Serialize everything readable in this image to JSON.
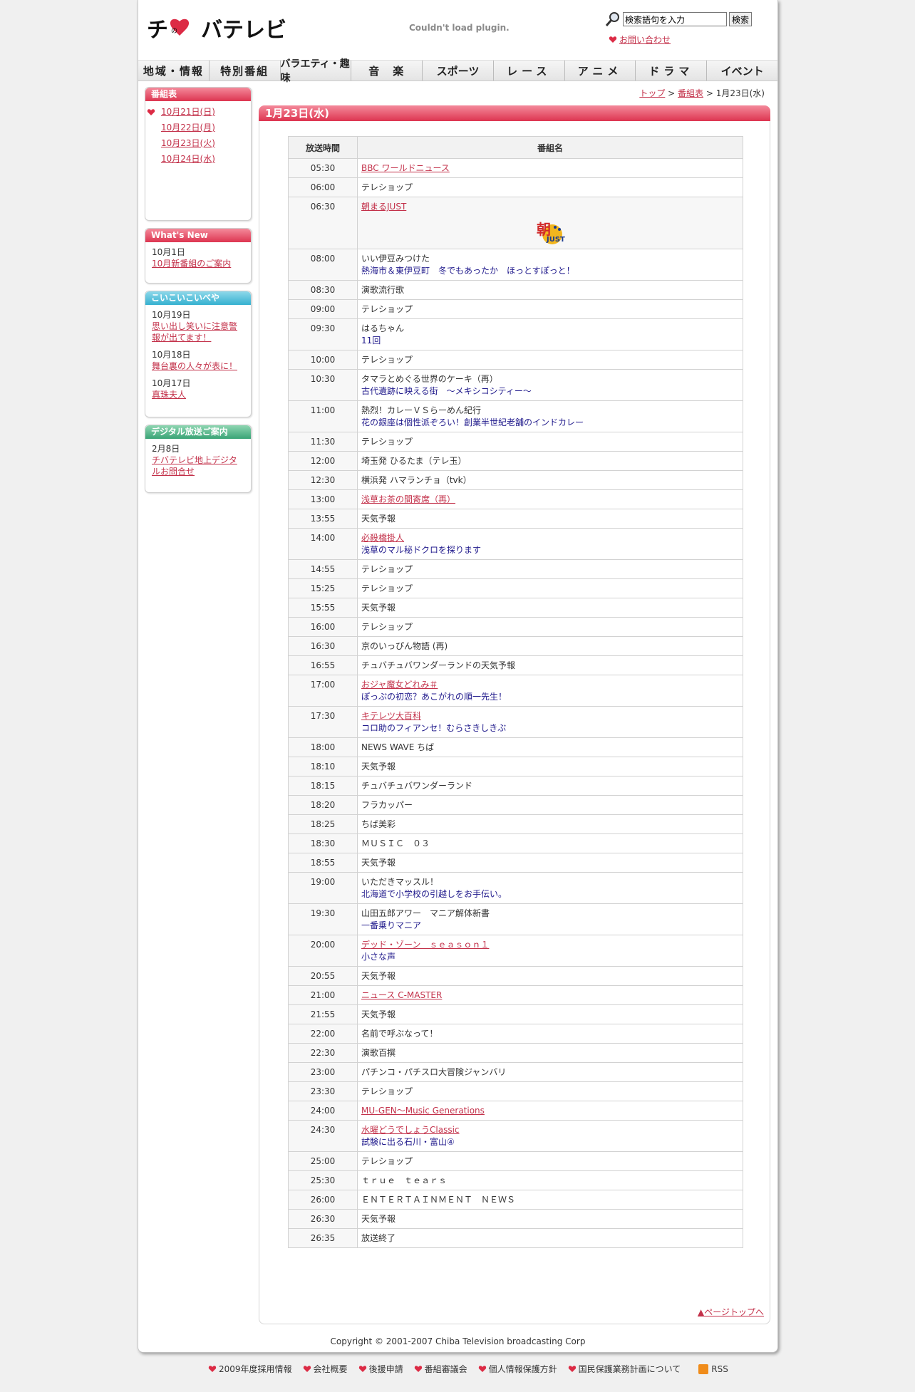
{
  "header": {
    "logo_text": "チバテレビ",
    "plugin_message": "Couldn't load plugin.",
    "search_placeholder": "検索語句を入力",
    "search_button": "検索",
    "contact": "お問い合わせ"
  },
  "nav": [
    "地域・情報",
    "特別番組",
    "バラエティ・趣味",
    "音　楽",
    "スポーツ",
    "レース",
    "アニメ",
    "ドラマ",
    "イベント"
  ],
  "sidebar": {
    "schedule": {
      "title": "番組表",
      "items": [
        "10月21日(日)",
        "10月22日(月)",
        "10月23日(火)",
        "10月24日(水)"
      ]
    },
    "whats_new": {
      "title": "What's New",
      "items": [
        {
          "date": "10月1日",
          "link": "10月新番組のご案内"
        }
      ]
    },
    "koikoi": {
      "title": "こいこいこいべや",
      "items": [
        {
          "date": "10月19日",
          "link": "思い出し笑いに注意警報が出てます！"
        },
        {
          "date": "10月18日",
          "link": "舞台裏の人々が表に！"
        },
        {
          "date": "10月17日",
          "link": "真珠夫人"
        }
      ]
    },
    "digital": {
      "title": "デジタル放送ご案内",
      "items": [
        {
          "date": "2月8日",
          "link": "チバテレビ地上デジタルお問合せ"
        }
      ]
    }
  },
  "breadcrumb": {
    "top": "トップ",
    "sep": " > ",
    "schedule": "番組表",
    "current": "1月23日(水)"
  },
  "main": {
    "title": "1月23日(水)",
    "col_time": "放送時間",
    "col_name": "番組名",
    "logo_label": "朝まるJUST",
    "rows": [
      {
        "time": "05:30",
        "title": "BBC ワールドニュース",
        "link": true
      },
      {
        "time": "06:00",
        "title": "テレショップ"
      },
      {
        "time": "06:30",
        "title": "朝まるJUST",
        "link": true,
        "logo": true
      },
      {
        "time": "08:00",
        "title": "いい伊豆みつけた",
        "sub": "熱海市＆東伊豆町　冬でもあったか　ほっとすぽっと！"
      },
      {
        "time": "08:30",
        "title": "演歌流行歌"
      },
      {
        "time": "09:00",
        "title": "テレショップ"
      },
      {
        "time": "09:30",
        "title": "はるちゃん",
        "sub": "11回"
      },
      {
        "time": "10:00",
        "title": "テレショップ"
      },
      {
        "time": "10:30",
        "title": "タマラとめぐる世界のケーキ（再）",
        "sub": "古代遺跡に映える街　～メキシコシティー～"
      },
      {
        "time": "11:00",
        "title": "熱烈！カレーＶＳらーめん紀行",
        "sub": "花の銀座は個性派ぞろい！創業半世紀老舗のインドカレー"
      },
      {
        "time": "11:30",
        "title": "テレショップ"
      },
      {
        "time": "12:00",
        "title": "埼玉発 ひるたま（テレ玉）"
      },
      {
        "time": "12:30",
        "title": "横浜発 ハマランチョ（tvk）"
      },
      {
        "time": "13:00",
        "title": "浅草お茶の間寄席（再）",
        "link": true
      },
      {
        "time": "13:55",
        "title": "天気予報"
      },
      {
        "time": "14:00",
        "title": "必殺橋掛人",
        "link": true,
        "sub": "浅草のマル秘ドクロを探ります"
      },
      {
        "time": "14:55",
        "title": "テレショップ"
      },
      {
        "time": "15:25",
        "title": "テレショップ"
      },
      {
        "time": "15:55",
        "title": "天気予報"
      },
      {
        "time": "16:00",
        "title": "テレショップ"
      },
      {
        "time": "16:30",
        "title": "京のいっぴん物語 (再)"
      },
      {
        "time": "16:55",
        "title": "チュバチュバワンダーランドの天気予報"
      },
      {
        "time": "17:00",
        "title": "おジャ魔女どれみ＃",
        "link": true,
        "sub": "ぽっぷの初恋？あこがれの順一先生！"
      },
      {
        "time": "17:30",
        "title": "キテレツ大百科",
        "link": true,
        "sub": "コロ助のフィアンセ！むらさきしきぶ"
      },
      {
        "time": "18:00",
        "title": "NEWS WAVE ちば"
      },
      {
        "time": "18:10",
        "title": "天気予報"
      },
      {
        "time": "18:15",
        "title": "チュバチュバワンダーランド"
      },
      {
        "time": "18:20",
        "title": "フラカッパー"
      },
      {
        "time": "18:25",
        "title": "ちば美彩"
      },
      {
        "time": "18:30",
        "title": "ＭＵＳＩＣ　０３"
      },
      {
        "time": "18:55",
        "title": "天気予報"
      },
      {
        "time": "19:00",
        "title": "いただきマッスル！",
        "sub": "北海道で小学校の引越しをお手伝い。"
      },
      {
        "time": "19:30",
        "title": "山田五郎アワー　マニア解体新書",
        "sub": "一番乗りマニア"
      },
      {
        "time": "20:00",
        "title": "デッド・ゾーン　ｓｅａｓｏｎ１",
        "link": true,
        "sub": "小さな声"
      },
      {
        "time": "20:55",
        "title": "天気予報"
      },
      {
        "time": "21:00",
        "title": "ニュース C-MASTER",
        "link": true
      },
      {
        "time": "21:55",
        "title": "天気予報"
      },
      {
        "time": "22:00",
        "title": "名前で呼ぶなって！"
      },
      {
        "time": "22:30",
        "title": "演歌百撰"
      },
      {
        "time": "23:00",
        "title": "パチンコ・パチスロ大冒険ジャンバリ"
      },
      {
        "time": "23:30",
        "title": "テレショップ"
      },
      {
        "time": "24:00",
        "title": "MU-GEN～Music Generations",
        "link": true
      },
      {
        "time": "24:30",
        "title": "水曜どうでしょうClassic",
        "link": true,
        "sub": "試験に出る石川・富山④"
      },
      {
        "time": "25:00",
        "title": "テレショップ"
      },
      {
        "time": "25:30",
        "title": "ｔｒｕｅ　ｔｅａｒｓ"
      },
      {
        "time": "26:00",
        "title": "ＥＮＴＥＲＴＡＩＮＭＥＮＴ　ＮＥＷＳ"
      },
      {
        "time": "26:30",
        "title": "天気予報"
      },
      {
        "time": "26:35",
        "title": "放送終了"
      }
    ],
    "page_top": "▲ページトップへ"
  },
  "copyright": "Copyright © 2001-2007 Chiba Television broadcasting Corp",
  "footer": [
    "2009年度採用情報",
    "会社概要",
    "後援申請",
    "番組審議会",
    "個人情報保護方針",
    "国民保護業務計画について"
  ],
  "rss": "RSS",
  "colors": {
    "accent": "#dd3550",
    "link": "#c3314a",
    "sub": "#201a8c"
  }
}
